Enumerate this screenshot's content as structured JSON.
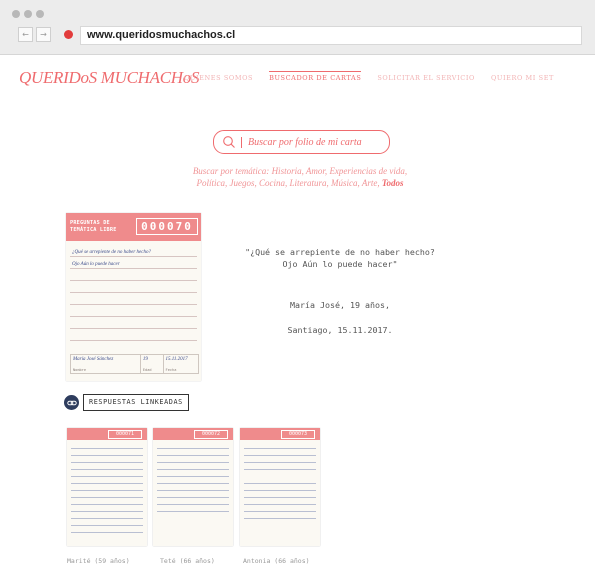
{
  "browser": {
    "url": "www.queridosmuchachos.cl",
    "back_icon": "←",
    "forward_icon": "→"
  },
  "header": {
    "logo": "QUERIDoS MUCHACHoS",
    "nav": [
      "QUIENES SOMOS",
      "BUSCADOR DE CARTAS",
      "SOLICITAR EL SERVICIO",
      "QUIERO MI SET"
    ],
    "active_nav": "BUSCADOR DE CARTAS"
  },
  "search": {
    "placeholder": "Buscar por folio de mi carta",
    "icon": "search-icon"
  },
  "filters": {
    "label": "Buscar por temática:",
    "items": [
      "Historia,",
      "Amor,",
      "Experiencias de vida,",
      "Política,",
      "Juegos,",
      "Cocina,",
      "Literatura,",
      "Música,",
      "Arte,"
    ],
    "all": "Todos"
  },
  "card": {
    "type": "PREGUNTAS DE TEMÁTICA LIBRE",
    "folio": "000070",
    "hand_line1": "¿Qué se arrepiente de no haber hecho?",
    "hand_line2": "Ojo Aún lo puede hacer",
    "footer_name": "María José Sánchez",
    "footer_age": "19",
    "footer_date": "15.11.2017",
    "footer_name_label": "Nombre",
    "footer_age_label": "Edad",
    "footer_date_label": "Fecha"
  },
  "quote": {
    "text": "\"¿Qué se arrepiente de no haber hecho? Ojo Aún lo puede hacer\"",
    "author": "María José, 19 años,",
    "place_date": "Santiago, 15.11.2017."
  },
  "linked": {
    "label": "RESPUESTAS LINKEADAS",
    "icon": "link-icon",
    "thumbs": [
      {
        "label": "Marité (59 años)",
        "folio": "000071"
      },
      {
        "label": "Teté (66 años)",
        "folio": "000072"
      },
      {
        "label": "Antonia (66 años)",
        "folio": "000073"
      }
    ]
  },
  "colors": {
    "accent": "#ef6b6e",
    "accent_light": "#f2b3b4",
    "card_header": "#ef8b8c",
    "link_badge": "#2e3d5e"
  }
}
